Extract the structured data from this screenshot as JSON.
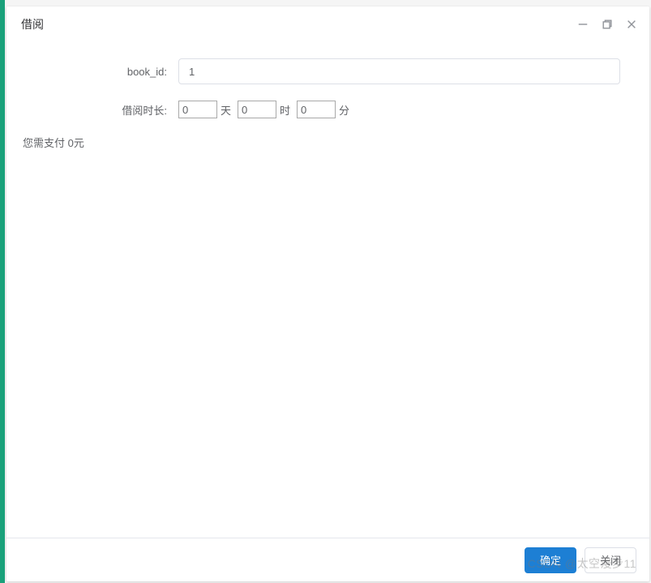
{
  "dialog": {
    "title": "借阅"
  },
  "form": {
    "book_id_label": "book_id:",
    "book_id_value": "1",
    "duration_label": "借阅时长:",
    "days_value": "0",
    "days_unit": "天",
    "hours_value": "0",
    "hours_unit": "时",
    "minutes_value": "0",
    "minutes_unit": "分",
    "pay_text": "您需支付 0元"
  },
  "footer": {
    "confirm_label": "确定",
    "close_label": "关闭"
  },
  "watermark": "CSDN @太空漫步11"
}
